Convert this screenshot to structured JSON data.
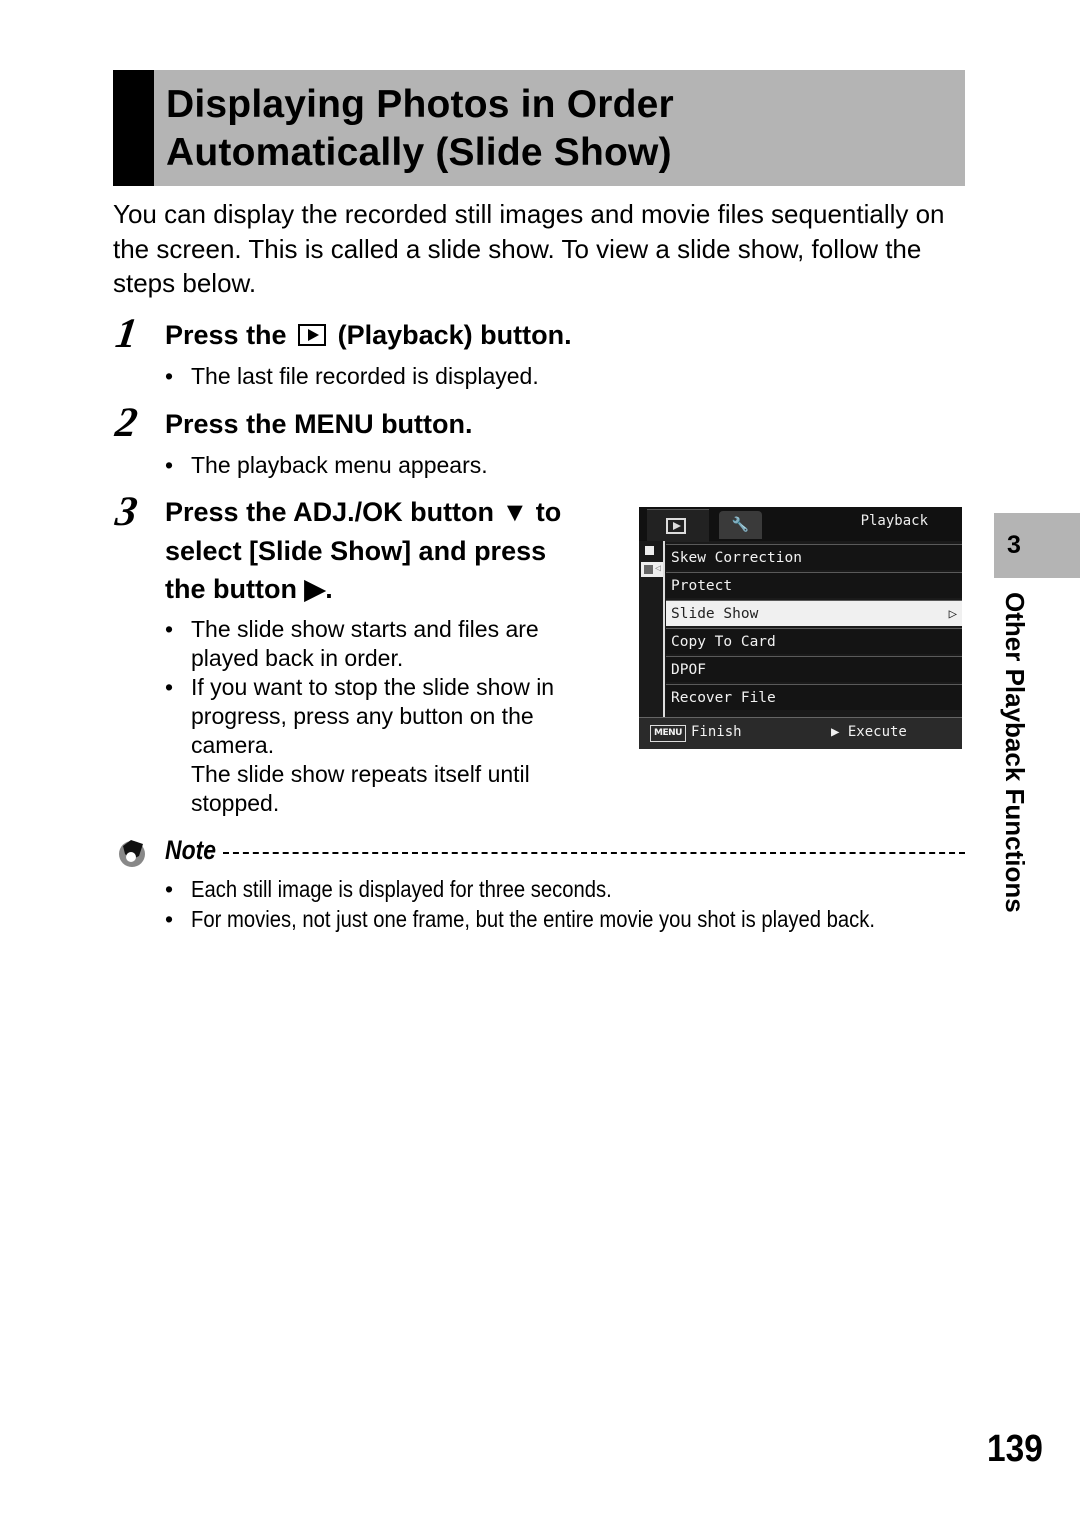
{
  "title": {
    "line1": "Displaying Photos in Order",
    "line2": "Automatically (Slide Show)"
  },
  "intro": "You can display the recorded still images and movie files sequentially on the screen. This is called a slide show. To view a slide show, follow the steps below.",
  "steps": [
    {
      "number": "1",
      "heading_pre": "Press the",
      "heading_icon": "playback-button-icon",
      "heading_post": "(Playback) button.",
      "bullets": [
        "The last file recorded is displayed."
      ]
    },
    {
      "number": "2",
      "heading": "Press the MENU button.",
      "bullets": [
        "The playback menu appears."
      ]
    },
    {
      "number": "3",
      "heading_lines": [
        "Press the ADJ./OK button ▼ to",
        "select [Slide Show] and press",
        "the button ▶."
      ],
      "bullets": [
        [
          "The slide show starts and files are",
          "played back in order."
        ],
        [
          "If you want to stop the slide show in",
          "progress, press any button on the",
          "camera.",
          "The slide show repeats itself until",
          "stopped."
        ]
      ]
    }
  ],
  "camera_screen": {
    "tab_title": "Playback",
    "tabs": [
      "playback-tab",
      "setup-tab"
    ],
    "items": [
      "Skew Correction",
      "Protect",
      "Slide Show",
      "Copy To Card",
      "DPOF",
      "Recover File"
    ],
    "selected_item": "Slide Show",
    "selected_chevron": "▷",
    "footer": {
      "menu_key": "MENU",
      "finish": "Finish",
      "execute": "▶ Execute"
    }
  },
  "note": {
    "label": "Note",
    "bullets": [
      "Each still image is displayed for three seconds.",
      "For movies, not just one frame, but the entire movie you shot is played back."
    ]
  },
  "side_tab": {
    "chapter_number": "3",
    "chapter_title": "Other Playback Functions"
  },
  "page_number": "139"
}
